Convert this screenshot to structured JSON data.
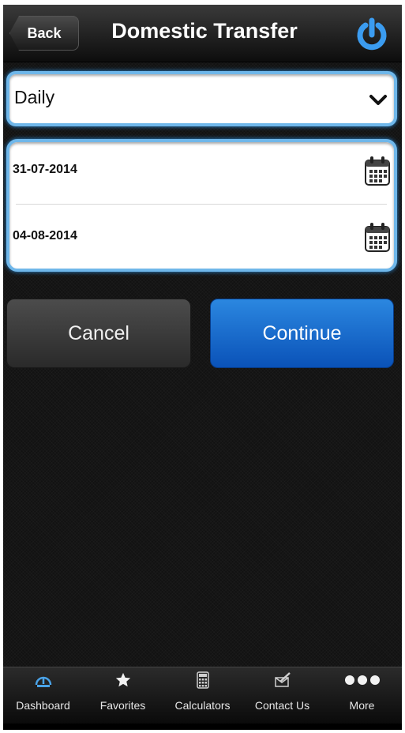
{
  "header": {
    "back_label": "Back",
    "title": "Domestic Transfer",
    "power_icon": "power-icon"
  },
  "frequency": {
    "value": "Daily",
    "icon": "chevron-down-icon"
  },
  "dates": {
    "start": "31-07-2014",
    "end": "04-08-2014",
    "icon": "calendar-icon"
  },
  "actions": {
    "cancel_label": "Cancel",
    "continue_label": "Continue"
  },
  "tabbar": {
    "items": [
      {
        "label": "Dashboard",
        "icon": "dashboard-gauge-icon"
      },
      {
        "label": "Favorites",
        "icon": "star-icon"
      },
      {
        "label": "Calculators",
        "icon": "calculator-icon"
      },
      {
        "label": "Contact Us",
        "icon": "contact-edit-icon"
      },
      {
        "label": "More",
        "icon": "more-dots-icon"
      }
    ]
  },
  "colors": {
    "accent_blue": "#0a52b8",
    "focus_border": "#6fb7ea",
    "power_icon": "#3b9cf0"
  }
}
